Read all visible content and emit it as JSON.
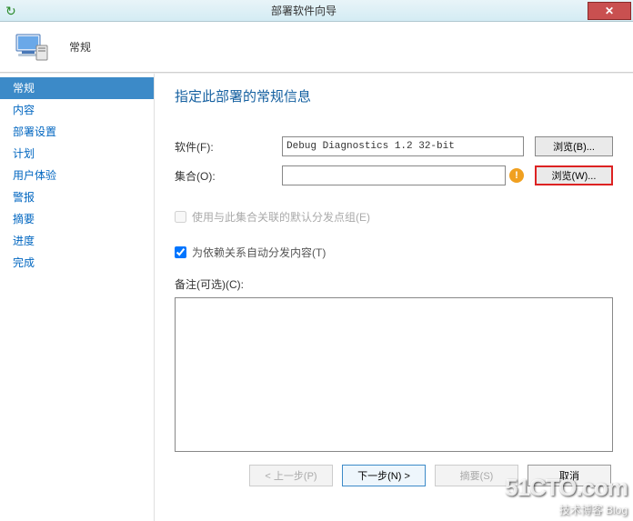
{
  "window": {
    "title": "部署软件向导",
    "close_glyph": "✕"
  },
  "header": {
    "label": "常规"
  },
  "sidebar": {
    "items": [
      {
        "label": "常规",
        "selected": true
      },
      {
        "label": "内容",
        "selected": false
      },
      {
        "label": "部署设置",
        "selected": false
      },
      {
        "label": "计划",
        "selected": false
      },
      {
        "label": "用户体验",
        "selected": false
      },
      {
        "label": "警报",
        "selected": false
      },
      {
        "label": "摘要",
        "selected": false
      },
      {
        "label": "进度",
        "selected": false
      },
      {
        "label": "完成",
        "selected": false
      }
    ]
  },
  "main": {
    "title": "指定此部署的常规信息",
    "software_label": "软件(F):",
    "software_value": "Debug Diagnostics 1.2 32-bit",
    "browse_b": "浏览(B)...",
    "collection_label": "集合(O):",
    "collection_value": "",
    "browse_w": "浏览(W)...",
    "use_assoc_label": "使用与此集合关联的默认分发点组(E)",
    "use_assoc_checked": false,
    "auto_dist_label": "为依赖关系自动分发内容(T)",
    "auto_dist_checked": true,
    "remark_label": "备注(可选)(C):",
    "remark_value": ""
  },
  "footer": {
    "prev": "< 上一步(P)",
    "next": "下一步(N) >",
    "summary": "摘要(S)",
    "cancel": "取消"
  },
  "watermark": {
    "line1": "51CTO.com",
    "line2": "技术博客   Blog"
  }
}
